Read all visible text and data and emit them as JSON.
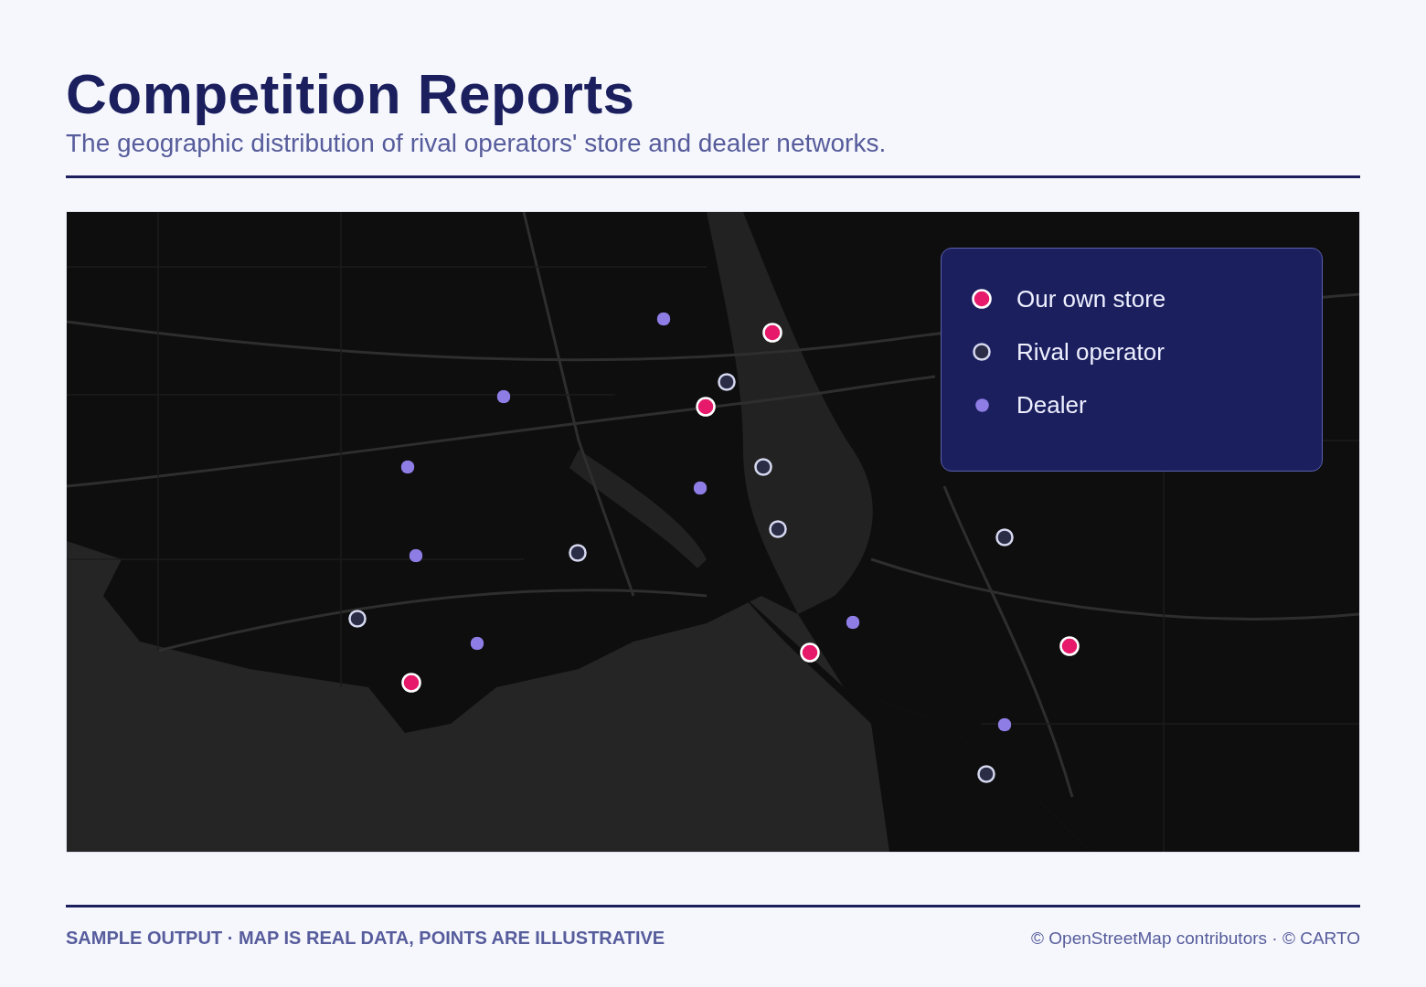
{
  "header": {
    "title": "Competition Reports",
    "subtitle": "The geographic distribution of rival operators' store and dealer networks."
  },
  "map": {
    "legend": [
      {
        "kind": "own",
        "label": "Our own store"
      },
      {
        "kind": "rival",
        "label": "Rival operator"
      },
      {
        "kind": "dealer",
        "label": "Dealer"
      }
    ],
    "points": [
      {
        "kind": "own"
      },
      {
        "kind": "own"
      },
      {
        "kind": "own"
      },
      {
        "kind": "own"
      },
      {
        "kind": "own"
      },
      {
        "kind": "rival"
      },
      {
        "kind": "rival"
      },
      {
        "kind": "rival"
      },
      {
        "kind": "rival"
      },
      {
        "kind": "rival"
      },
      {
        "kind": "rival"
      },
      {
        "kind": "rival"
      },
      {
        "kind": "dealer"
      },
      {
        "kind": "dealer"
      },
      {
        "kind": "dealer"
      },
      {
        "kind": "dealer"
      },
      {
        "kind": "dealer"
      },
      {
        "kind": "dealer"
      },
      {
        "kind": "dealer"
      },
      {
        "kind": "dealer"
      }
    ]
  },
  "footer": {
    "note": "SAMPLE OUTPUT · MAP IS REAL DATA, POINTS ARE ILLUSTRATIVE",
    "credit": "© OpenStreetMap contributors · © CARTO"
  }
}
